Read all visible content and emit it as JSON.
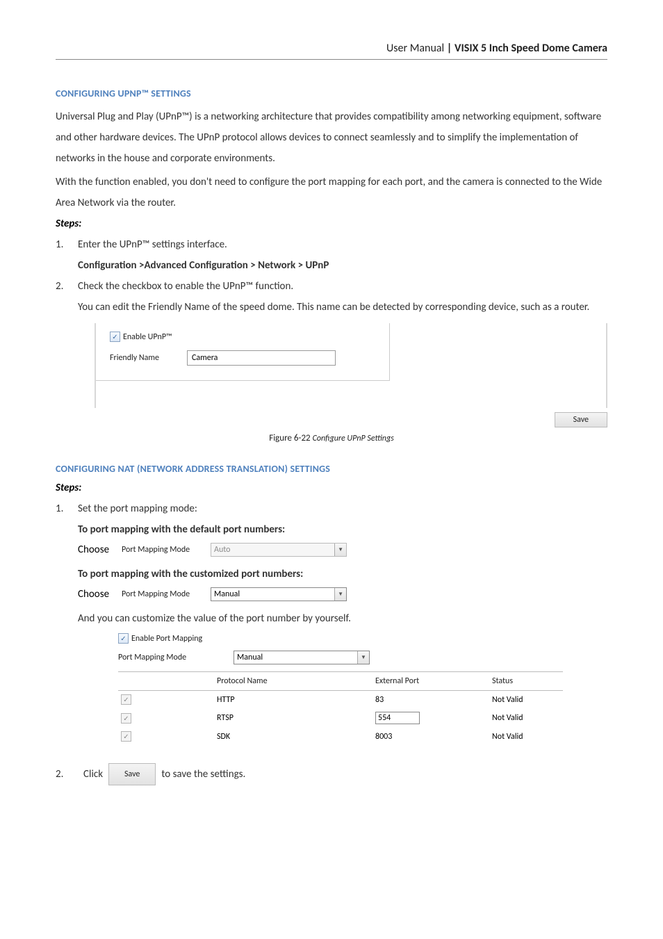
{
  "header": {
    "lead": "User Manual",
    "sep": " | ",
    "product": "VISIX 5 Inch Speed Dome Camera"
  },
  "sectionA": {
    "title": "CONFIGURING UPNP™ SETTINGS",
    "para1": "Universal Plug and Play (UPnP™) is a networking architecture that provides compatibility among networking equipment, software and other hardware devices. The UPnP protocol allows devices to connect seamlessly and to simplify the implementation of networks in the house and corporate environments.",
    "para2": "With the function enabled, you don't need to configure the port mapping for each port, and the camera is connected to the Wide Area Network via the router.",
    "steps_label": "Steps:",
    "step1_num": "1.",
    "step1_text": "Enter the UPnP™ settings interface.",
    "step1_path": "Configuration >Advanced Configuration > Network > UPnP",
    "step2_num": "2.",
    "step2_text": "Check the checkbox to enable the UPnP™ function.",
    "step2_text2": "You can edit the Friendly Name of the speed dome. This name can be detected by corresponding device, such as a router."
  },
  "fig1": {
    "chk_label": "Enable UPnP™",
    "friendly_label": "Friendly Name",
    "friendly_value": "Camera",
    "save": "Save",
    "caption_lead": "Figure 6-22 ",
    "caption_italic": "Configure UPnP Settings"
  },
  "sectionB": {
    "title": "CONFIGURING NAT (NETWORK ADDRESS TRANSLATION) SETTINGS",
    "steps_label": "Steps:",
    "step1_num": "1.",
    "step1_text": "Set the port mapping mode:",
    "heading_default": "To port mapping with the default port numbers:",
    "choose": "Choose",
    "pmm_label": "Port Mapping Mode",
    "auto": "Auto",
    "heading_custom": "To port mapping with the customized port numbers:",
    "manual": "Manual",
    "customize_text": "And you can customize the value of the port number by yourself."
  },
  "port_table": {
    "chk_label": "Enable Port Mapping",
    "pmm_label": "Port Mapping Mode",
    "mode_value": "Manual",
    "headers": {
      "protocol": "Protocol Name",
      "ext": "External Port",
      "status": "Status"
    },
    "rows": [
      {
        "protocol": "HTTP",
        "ext": "83",
        "status": "Not Valid",
        "boxed": false
      },
      {
        "protocol": "RTSP",
        "ext": "554",
        "status": "Not Valid",
        "boxed": true
      },
      {
        "protocol": "SDK",
        "ext": "8003",
        "status": "Not Valid",
        "boxed": false
      }
    ]
  },
  "stepB2": {
    "num": "2.",
    "click": "Click",
    "save": "Save",
    "tail": "to save the settings."
  }
}
